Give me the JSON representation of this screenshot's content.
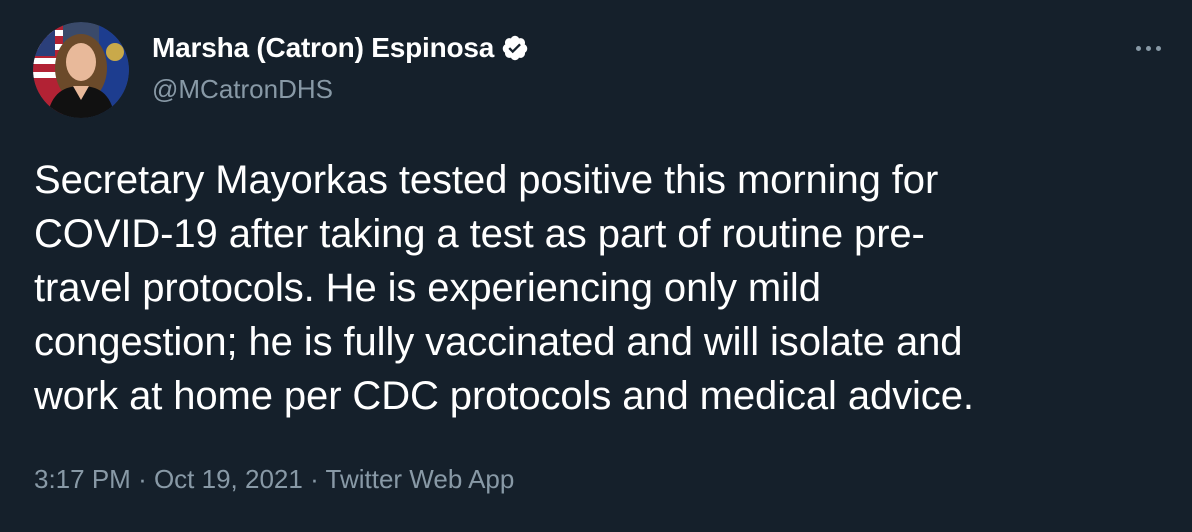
{
  "author": {
    "display_name": "Marsha (Catron) Espinosa",
    "handle": "@MCatronDHS",
    "verified": true
  },
  "tweet": {
    "lines": [
      "Secretary Mayorkas tested positive this morning for",
      "COVID-19 after taking a test as part of routine pre-",
      "travel protocols. He is experiencing only mild",
      "congestion; he is fully vaccinated and will isolate and",
      "work at home per CDC protocols and medical advice."
    ]
  },
  "meta": {
    "time": "3:17 PM",
    "separator": "·",
    "date": "Oct 19, 2021",
    "source": "Twitter Web App"
  },
  "icons": {
    "verified": "verified-badge-icon",
    "more": "more-options-icon"
  },
  "colors": {
    "background": "#15202b",
    "text_primary": "#ffffff",
    "text_secondary": "#8899a6"
  }
}
